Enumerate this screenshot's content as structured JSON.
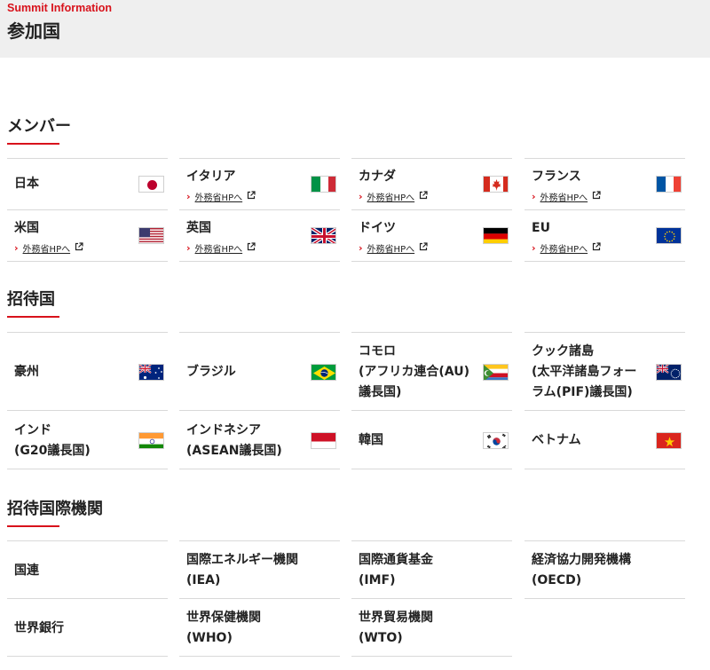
{
  "header": {
    "eyebrow": "Summit Information",
    "title": "参加国"
  },
  "sections": {
    "members": {
      "title": "メンバー"
    },
    "invited": {
      "title": "招待国"
    },
    "orgs": {
      "title": "招待国際機関"
    }
  },
  "link_label": "外務省HPへ",
  "members": [
    {
      "name": "日本",
      "flag": "japan-flag"
    },
    {
      "name": "イタリア",
      "flag": "italy-flag",
      "link": "外務省HPへ"
    },
    {
      "name": "カナダ",
      "flag": "canada-flag",
      "link": "外務省HPへ"
    },
    {
      "name": "フランス",
      "flag": "france-flag",
      "link": "外務省HPへ"
    },
    {
      "name": "米国",
      "flag": "usa-flag",
      "link": "外務省HPへ"
    },
    {
      "name": "英国",
      "flag": "uk-flag",
      "link": "外務省HPへ"
    },
    {
      "name": "ドイツ",
      "flag": "germany-flag",
      "link": "外務省HPへ"
    },
    {
      "name": "EU",
      "flag": "eu-flag",
      "link": "外務省HPへ"
    }
  ],
  "invited": [
    {
      "lines": [
        "豪州"
      ],
      "flag": "australia-flag"
    },
    {
      "lines": [
        "ブラジル"
      ],
      "flag": "brazil-flag"
    },
    {
      "lines": [
        "コモロ",
        "(アフリカ連合(AU)",
        "議長国)"
      ],
      "flag": "comoros-flag"
    },
    {
      "lines": [
        "クック諸島",
        "(太平洋諸島フォー",
        "ラム(PIF)議長国)"
      ],
      "flag": "cook-islands-flag"
    },
    {
      "lines": [
        "インド",
        "(G20議長国)"
      ],
      "flag": "india-flag"
    },
    {
      "lines": [
        "インドネシア",
        "(ASEAN議長国)"
      ],
      "flag": "indonesia-flag"
    },
    {
      "lines": [
        "韓国"
      ],
      "flag": "korea-flag"
    },
    {
      "lines": [
        "ベトナム"
      ],
      "flag": "vietnam-flag"
    }
  ],
  "orgs": [
    {
      "lines": [
        "国連"
      ]
    },
    {
      "lines": [
        "国際エネルギー機関",
        "(IEA)"
      ]
    },
    {
      "lines": [
        "国際通貨基金",
        "(IMF)"
      ]
    },
    {
      "lines": [
        "経済協力開発機構",
        "(OECD)"
      ]
    },
    {
      "lines": [
        "世界銀行"
      ]
    },
    {
      "lines": [
        "世界保健機関",
        "(WHO)"
      ]
    },
    {
      "lines": [
        "世界貿易機関",
        "(WTO)"
      ]
    }
  ],
  "colors": {
    "accent": "#d8121b",
    "header_bg": "#efefef",
    "border": "#d9d9d9"
  }
}
